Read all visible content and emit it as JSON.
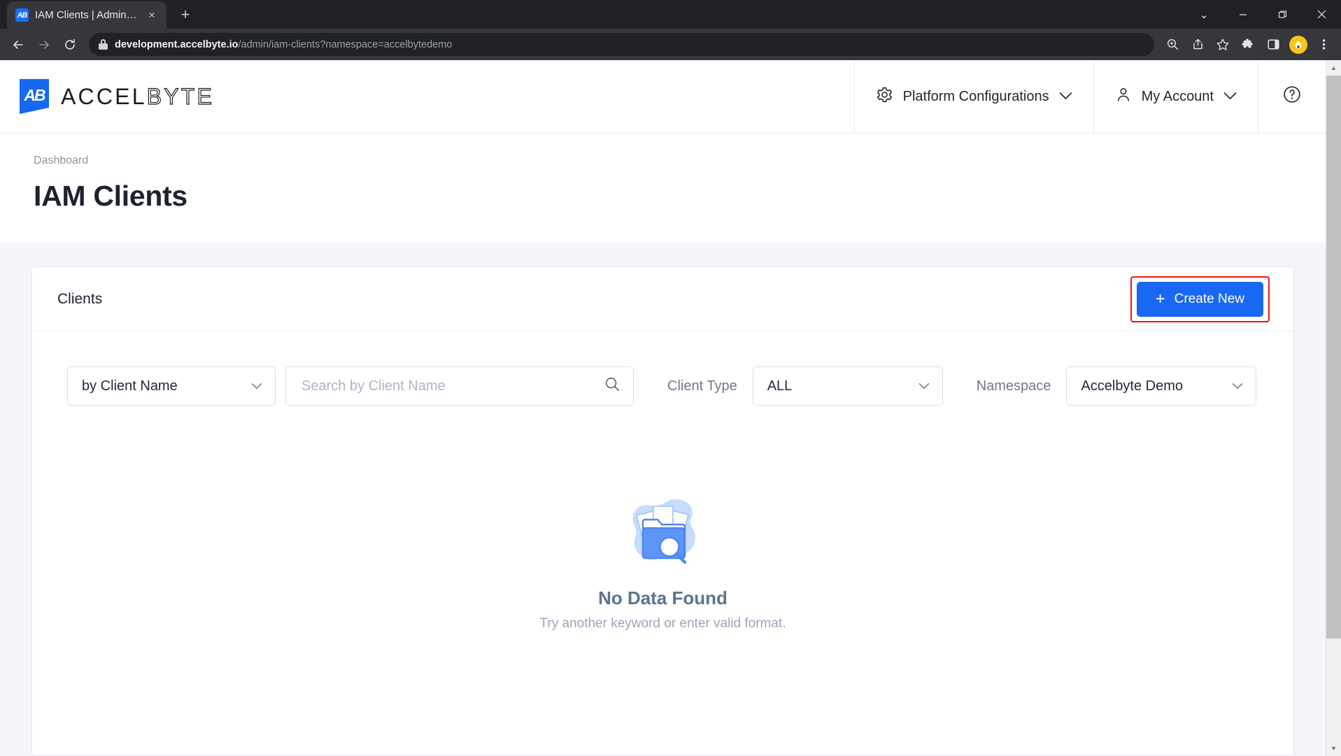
{
  "browser": {
    "tab": {
      "title": "IAM Clients | Admin Portal",
      "favicon": "accelbyte-favicon",
      "close": "×"
    },
    "new_tab": "+",
    "window_controls": {
      "minimize": "—",
      "maximize": "❐",
      "close": "✕",
      "tab_search": "⌄"
    },
    "nav": {
      "back": "←",
      "forward": "→",
      "reload": "⟳"
    },
    "address": {
      "host": "development.accelbyte.io",
      "path": "/admin/iam-clients?namespace=accelbytedemo",
      "secure_icon": "lock-icon"
    },
    "toolbar_icons": [
      "zoom-icon",
      "share-icon",
      "bookmark-star-icon",
      "extensions-puzzle-icon",
      "side-panel-icon",
      "profile-avatar-icon",
      "chrome-menu-icon"
    ]
  },
  "appbar": {
    "brand": {
      "mark": "AB",
      "name_solid": "ACCEL",
      "name_outline": "BYTE"
    },
    "items": [
      {
        "label": "Platform Configurations",
        "icon": "gear-icon",
        "caret": "⌄"
      },
      {
        "label": "My Account",
        "icon": "user-icon",
        "caret": "⌄"
      }
    ],
    "help": {
      "icon": "help-circle-icon",
      "glyph": "?"
    }
  },
  "page": {
    "breadcrumb": "Dashboard",
    "title": "IAM Clients"
  },
  "card": {
    "title": "Clients",
    "create_button": {
      "label": "Create New",
      "plus": "+",
      "color": "#1868f4",
      "highlight_color": "#f51212"
    }
  },
  "filters": {
    "search_by": {
      "value": "by Client Name",
      "caret": "⌄"
    },
    "search": {
      "placeholder": "Search by Client Name",
      "value": "",
      "icon": "search-icon"
    },
    "client_type": {
      "label": "Client Type",
      "value": "ALL",
      "caret": "⌄"
    },
    "namespace": {
      "label": "Namespace",
      "value": "Accelbyte Demo",
      "caret": "⌄"
    }
  },
  "empty_state": {
    "illustration": "folder-search-empty-icon",
    "title": "No Data Found",
    "subtitle": "Try another keyword or enter valid format."
  },
  "scrollbar": {
    "up": "▲",
    "down": "▼"
  }
}
